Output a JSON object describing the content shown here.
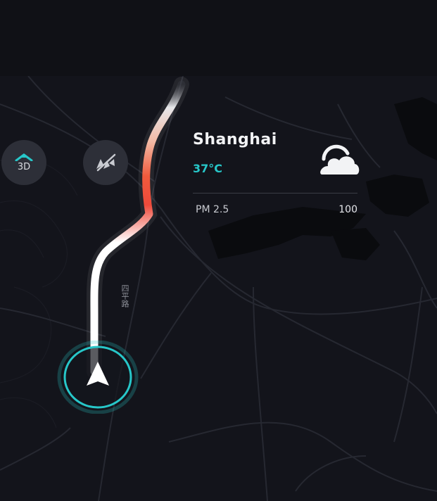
{
  "map_controls": {
    "view_mode_label": "3D",
    "view_mode_icon": "3d-view-icon",
    "voice_icon": "voice-mute-icon"
  },
  "weather": {
    "city": "Shanghai",
    "temperature": "37°C",
    "condition_icon": "partly-cloudy-icon",
    "pm_label": "PM 2.5",
    "pm_value": "100"
  },
  "map": {
    "road_label": "四平路"
  },
  "colors": {
    "accent": "#27c7c9",
    "congestion": "#f05a3c",
    "route": "#ffffff"
  },
  "vehicle_icon": "navigation-arrow-icon"
}
